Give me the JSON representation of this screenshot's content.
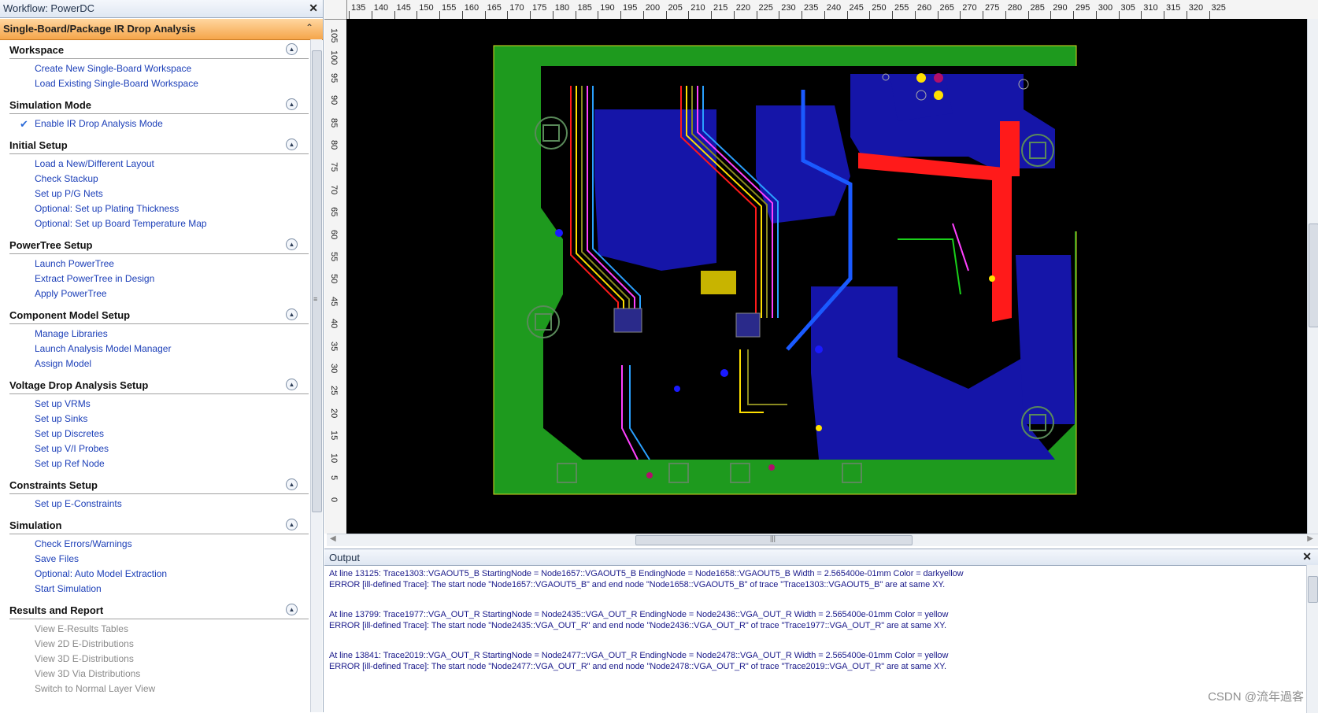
{
  "workflow": {
    "window_title": "Workflow: PowerDC",
    "header": "Single-Board/Package IR Drop Analysis",
    "sections": [
      {
        "title": "Workspace",
        "items": [
          {
            "label": "Create New Single-Board Workspace"
          },
          {
            "label": "Load Existing Single-Board Workspace"
          }
        ]
      },
      {
        "title": "Simulation Mode",
        "items": [
          {
            "label": "Enable IR Drop Analysis Mode",
            "checked": true
          }
        ]
      },
      {
        "title": "Initial Setup",
        "items": [
          {
            "label": "Load a New/Different Layout"
          },
          {
            "label": "Check Stackup"
          },
          {
            "label": "Set up P/G Nets"
          },
          {
            "label": "Optional: Set up Plating Thickness"
          },
          {
            "label": "Optional: Set up Board Temperature Map"
          }
        ]
      },
      {
        "title": "PowerTree Setup",
        "items": [
          {
            "label": "Launch PowerTree"
          },
          {
            "label": "Extract PowerTree in Design"
          },
          {
            "label": "Apply PowerTree"
          }
        ]
      },
      {
        "title": "Component Model Setup",
        "items": [
          {
            "label": "Manage Libraries"
          },
          {
            "label": "Launch Analysis Model Manager"
          },
          {
            "label": "Assign Model"
          }
        ]
      },
      {
        "title": "Voltage Drop Analysis Setup",
        "items": [
          {
            "label": "Set up VRMs"
          },
          {
            "label": "Set up Sinks"
          },
          {
            "label": "Set up Discretes"
          },
          {
            "label": "Set up V/I Probes"
          },
          {
            "label": "Set up Ref Node"
          }
        ]
      },
      {
        "title": "Constraints Setup",
        "items": [
          {
            "label": "Set up E-Constraints"
          }
        ]
      },
      {
        "title": "Simulation",
        "items": [
          {
            "label": "Check Errors/Warnings"
          },
          {
            "label": "Save Files"
          },
          {
            "label": "Optional: Auto Model Extraction"
          },
          {
            "label": "Start Simulation"
          }
        ]
      },
      {
        "title": "Results and Report",
        "items": [
          {
            "label": "View E-Results Tables",
            "disabled": true
          },
          {
            "label": "View 2D E-Distributions",
            "disabled": true
          },
          {
            "label": "View 3D E-Distributions",
            "disabled": true
          },
          {
            "label": "View 3D Via Distributions",
            "disabled": true
          },
          {
            "label": "Switch to Normal Layer View",
            "disabled": true
          }
        ]
      }
    ]
  },
  "ruler": {
    "top_ticks": [
      "135",
      "140",
      "145",
      "150",
      "155",
      "160",
      "165",
      "170",
      "175",
      "180",
      "185",
      "190",
      "195",
      "200",
      "205",
      "210",
      "215",
      "220",
      "225",
      "230",
      "235",
      "240",
      "245",
      "250",
      "255",
      "260",
      "265",
      "270",
      "275",
      "280",
      "285",
      "290",
      "295",
      "300",
      "305",
      "310",
      "315",
      "320",
      "325"
    ],
    "left_ticks": [
      "105",
      "100",
      "95",
      "90",
      "85",
      "80",
      "75",
      "70",
      "65",
      "60",
      "55",
      "50",
      "45",
      "40",
      "35",
      "30",
      "25",
      "20",
      "15",
      "10",
      "5",
      "0"
    ]
  },
  "output": {
    "title": "Output",
    "blocks": [
      [
        "At line 13125: Trace1303::VGAOUT5_B StartingNode = Node1657::VGAOUT5_B EndingNode = Node1658::VGAOUT5_B Width = 2.565400e-01mm Color = darkyellow",
        "ERROR [ill-defined Trace]: The start node \"Node1657::VGAOUT5_B\" and end node \"Node1658::VGAOUT5_B\" of trace \"Trace1303::VGAOUT5_B\" are at same XY."
      ],
      [
        "At line 13799: Trace1977::VGA_OUT_R StartingNode = Node2435::VGA_OUT_R EndingNode = Node2436::VGA_OUT_R Width = 2.565400e-01mm Color = yellow",
        "ERROR [ill-defined Trace]: The start node \"Node2435::VGA_OUT_R\" and end node \"Node2436::VGA_OUT_R\" of trace \"Trace1977::VGA_OUT_R\" are at same XY."
      ],
      [
        "At line 13841: Trace2019::VGA_OUT_R StartingNode = Node2477::VGA_OUT_R EndingNode = Node2478::VGA_OUT_R Width = 2.565400e-01mm Color = yellow",
        "ERROR [ill-defined Trace]: The start node \"Node2477::VGA_OUT_R\" and end node \"Node2478::VGA_OUT_R\" of trace \"Trace2019::VGA_OUT_R\" are at same XY."
      ]
    ]
  },
  "watermark": "CSDN @流年過客",
  "colors": {
    "board_green": "#1e9a1e",
    "plane_blue": "#1515a8",
    "trace_red": "#ff1a1a",
    "trace_yellow": "#ffe000",
    "header_orange": "#f5a54a",
    "link_blue": "#1c3fb8"
  },
  "icons": [
    "close-icon",
    "collapse-up-icon",
    "check-icon",
    "scroll-grip-icon"
  ]
}
